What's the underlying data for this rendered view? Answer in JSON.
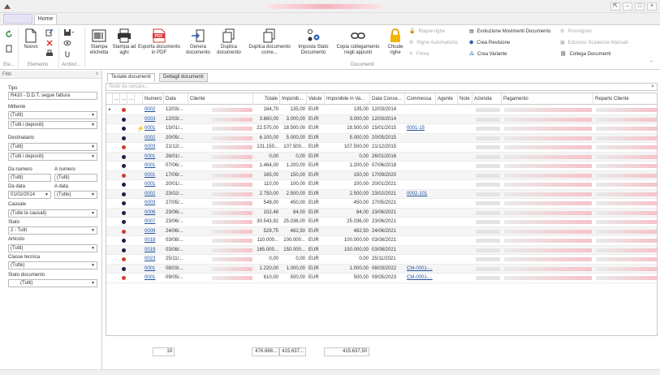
{
  "window": {
    "tab_home": "Home"
  },
  "ribbon": {
    "nuovo": "Nuovo",
    "group_elemento": "Elemento",
    "group_archivio": "Archivi...",
    "group_ele": "Ele...",
    "stampa_etichetta": "Stampa etichetta",
    "stampa_ad_aghi": "Stampa ad aghi",
    "esporta_pdf": "Esporta documento in PDF",
    "genera_documento": "Genera documento",
    "duplica_documento": "Duplica documento",
    "duplica_documento_come": "Duplica documento come...",
    "imposta_stato": "Imposta Stato Documento",
    "copia_collegamento": "Copia collegamento negli appunti",
    "chiude_righe": "Chiude righe",
    "riapre_righe": "Riapre righe",
    "righe_automatiche": "Righe Automatiche",
    "firma": "Firma",
    "evoluzione_movimenti": "Evoluzione Movimenti Documento",
    "crea_revisione": "Crea Revisione",
    "crea_variante": "Crea Variante",
    "provvigioni": "Provvigioni",
    "edizione_scadenze": "Edizione Scadenze Manuali",
    "collega_documenti": "Collega Documenti",
    "group_documenti": "Documenti"
  },
  "filters": {
    "header": "Filtri",
    "tipo_label": "Tipo",
    "tipo_value": "R410 - D.D.T. segue fattura",
    "mittente_label": "Mittente",
    "mittente_1": "(Tutti)",
    "mittente_2": "(Tutti i depositi)",
    "destinatario_label": "Destinatario",
    "destinatario_1": "(Tutti)",
    "destinatario_2": "(Tutti i depositi)",
    "da_numero_label": "Da numero",
    "a_numero_label": "A numero",
    "da_numero": "(Tutti)",
    "a_numero": "(Tutti)",
    "da_data_label": "Da data",
    "a_data_label": "A data",
    "da_data": "01/02/2014",
    "a_data": "(Tutte)",
    "causale_label": "Causale",
    "causale_value": "(Tutte le causali)",
    "stato_label": "Stato",
    "stato_value": "2 - Tutti",
    "articolo_label": "Articolo",
    "articolo_value": "(Tutti)",
    "classe_label": "Classe tecnica",
    "classe_value": "(Tutte)",
    "stato_doc_label": "Stato documento",
    "stato_doc_value": "(Tutti)"
  },
  "tabs": {
    "testate": "Testate documenti",
    "dettagli": "Dettagli documenti"
  },
  "search_placeholder": "Testo da cercare...",
  "columns": {
    "c1": "...",
    "c2": "...",
    "c3": "...",
    "numero": "Numero",
    "data": "Data",
    "cliente": "Cliente",
    "totale": "Totale",
    "imponibile": "Imponib...",
    "valuta": "Valute",
    "imp_va": "Imponibile in Va...",
    "data_cons": "Data Conse...",
    "commessa": "Commessa",
    "agente": "Agente",
    "note": "Note",
    "azienda": "Azienda",
    "pagamento": "Pagamento",
    "reparto": "Reparto Cliente"
  },
  "colors": {
    "red": "#d33a2c",
    "navy": "#1b1f4a",
    "link": "#1f4f9e"
  },
  "rows": [
    {
      "dot": "red",
      "flag": "",
      "numero": "0002",
      "data": "12/03/...",
      "totale": "164,70",
      "imp": "135,00",
      "val": "EUR",
      "impva": "135,00",
      "cons": "12/03/2014",
      "comm": ""
    },
    {
      "dot": "navy",
      "flag": "",
      "numero": "0003",
      "data": "12/03/...",
      "totale": "3.660,00",
      "imp": "3.000,00",
      "val": "EUR",
      "impva": "3.000,00",
      "cons": "12/03/2014",
      "comm": ""
    },
    {
      "dot": "navy",
      "flag": "bolt",
      "numero": "0001",
      "data": "15/01/...",
      "totale": "22.570,00",
      "imp": "18.500,00",
      "val": "EUR",
      "impva": "18.500,00",
      "cons": "15/01/2015",
      "comm": "0001-15"
    },
    {
      "dot": "navy",
      "flag": "",
      "numero": "0002",
      "data": "20/05/...",
      "totale": "6.100,00",
      "imp": "5.000,00",
      "val": "EUR",
      "impva": "5.000,00",
      "cons": "20/05/2015",
      "comm": ""
    },
    {
      "dot": "red",
      "flag": "",
      "numero": "0003",
      "data": "21/12/...",
      "totale": "131.150...",
      "imp": "107.500...",
      "val": "EUR",
      "impva": "107.500,00",
      "cons": "21/12/2015",
      "comm": ""
    },
    {
      "dot": "navy",
      "flag": "",
      "numero": "0001",
      "data": "26/01/...",
      "totale": "0,00",
      "imp": "0,00",
      "val": "EUR",
      "impva": "0,00",
      "cons": "26/01/2016",
      "comm": ""
    },
    {
      "dot": "navy",
      "flag": "",
      "numero": "0001",
      "data": "07/06/...",
      "totale": "1.464,00",
      "imp": "1.200,00",
      "val": "EUR",
      "impva": "1.200,00",
      "cons": "07/06/2018",
      "comm": ""
    },
    {
      "dot": "red",
      "flag": "",
      "numero": "0001",
      "data": "17/09/...",
      "totale": "165,00",
      "imp": "150,00",
      "val": "EUR",
      "impva": "150,00",
      "cons": "17/09/2020",
      "comm": ""
    },
    {
      "dot": "navy",
      "flag": "",
      "numero": "0001",
      "data": "20/01/...",
      "totale": "110,00",
      "imp": "100,00",
      "val": "EUR",
      "impva": "100,00",
      "cons": "20/01/2021",
      "comm": ""
    },
    {
      "dot": "navy",
      "flag": "",
      "numero": "0002",
      "data": "23/02/...",
      "totale": "2.750,00",
      "imp": "2.500,00",
      "val": "EUR",
      "impva": "2.500,00",
      "cons": "23/02/2021",
      "comm": "0002-101"
    },
    {
      "dot": "navy",
      "flag": "",
      "numero": "0003",
      "data": "27/05/...",
      "totale": "549,00",
      "imp": "450,00",
      "val": "EUR",
      "impva": "450,00",
      "cons": "27/05/2021",
      "comm": ""
    },
    {
      "dot": "navy",
      "flag": "",
      "numero": "0006",
      "data": "23/06/...",
      "totale": "102,48",
      "imp": "84,00",
      "val": "EUR",
      "impva": "84,00",
      "cons": "23/06/2021",
      "comm": ""
    },
    {
      "dot": "navy",
      "flag": "",
      "numero": "0007",
      "data": "23/06/...",
      "totale": "30.543,92",
      "imp": "25.036,00",
      "val": "EUR",
      "impva": "25.036,00",
      "cons": "23/06/2021",
      "comm": ""
    },
    {
      "dot": "red",
      "flag": "",
      "numero": "0009",
      "data": "24/06/...",
      "totale": "529,75",
      "imp": "482,50",
      "val": "EUR",
      "impva": "482,50",
      "cons": "24/06/2021",
      "comm": ""
    },
    {
      "dot": "navy",
      "flag": "",
      "numero": "0018",
      "data": "03/08/...",
      "totale": "110.000...",
      "imp": "100.000...",
      "val": "EUR",
      "impva": "100.000,00",
      "cons": "03/08/2021",
      "comm": ""
    },
    {
      "dot": "navy",
      "flag": "",
      "numero": "0019",
      "data": "03/08/...",
      "totale": "165.000...",
      "imp": "150.000...",
      "val": "EUR",
      "impva": "150.000,00",
      "cons": "03/08/2021",
      "comm": ""
    },
    {
      "dot": "red",
      "flag": "",
      "numero": "0023",
      "data": "25/11/...",
      "totale": "0,00",
      "imp": "0,00",
      "val": "EUR",
      "impva": "0,00",
      "cons": "25/11/2021",
      "comm": ""
    },
    {
      "dot": "navy",
      "flag": "",
      "numero": "0001",
      "data": "08/03/...",
      "totale": "1.220,00",
      "imp": "1.000,00",
      "val": "EUR",
      "impva": "1.000,00",
      "cons": "08/03/2022",
      "comm": "CM-0001-..."
    },
    {
      "dot": "red",
      "flag": "",
      "numero": "0001",
      "data": "09/05/...",
      "totale": "610,00",
      "imp": "500,00",
      "val": "EUR",
      "impva": "500,00",
      "cons": "09/05/2023",
      "comm": "CM-0001-..."
    }
  ],
  "totals": {
    "count": "19",
    "totale": "476.688...",
    "imp": "415.637...",
    "impva": "415.637,50"
  }
}
